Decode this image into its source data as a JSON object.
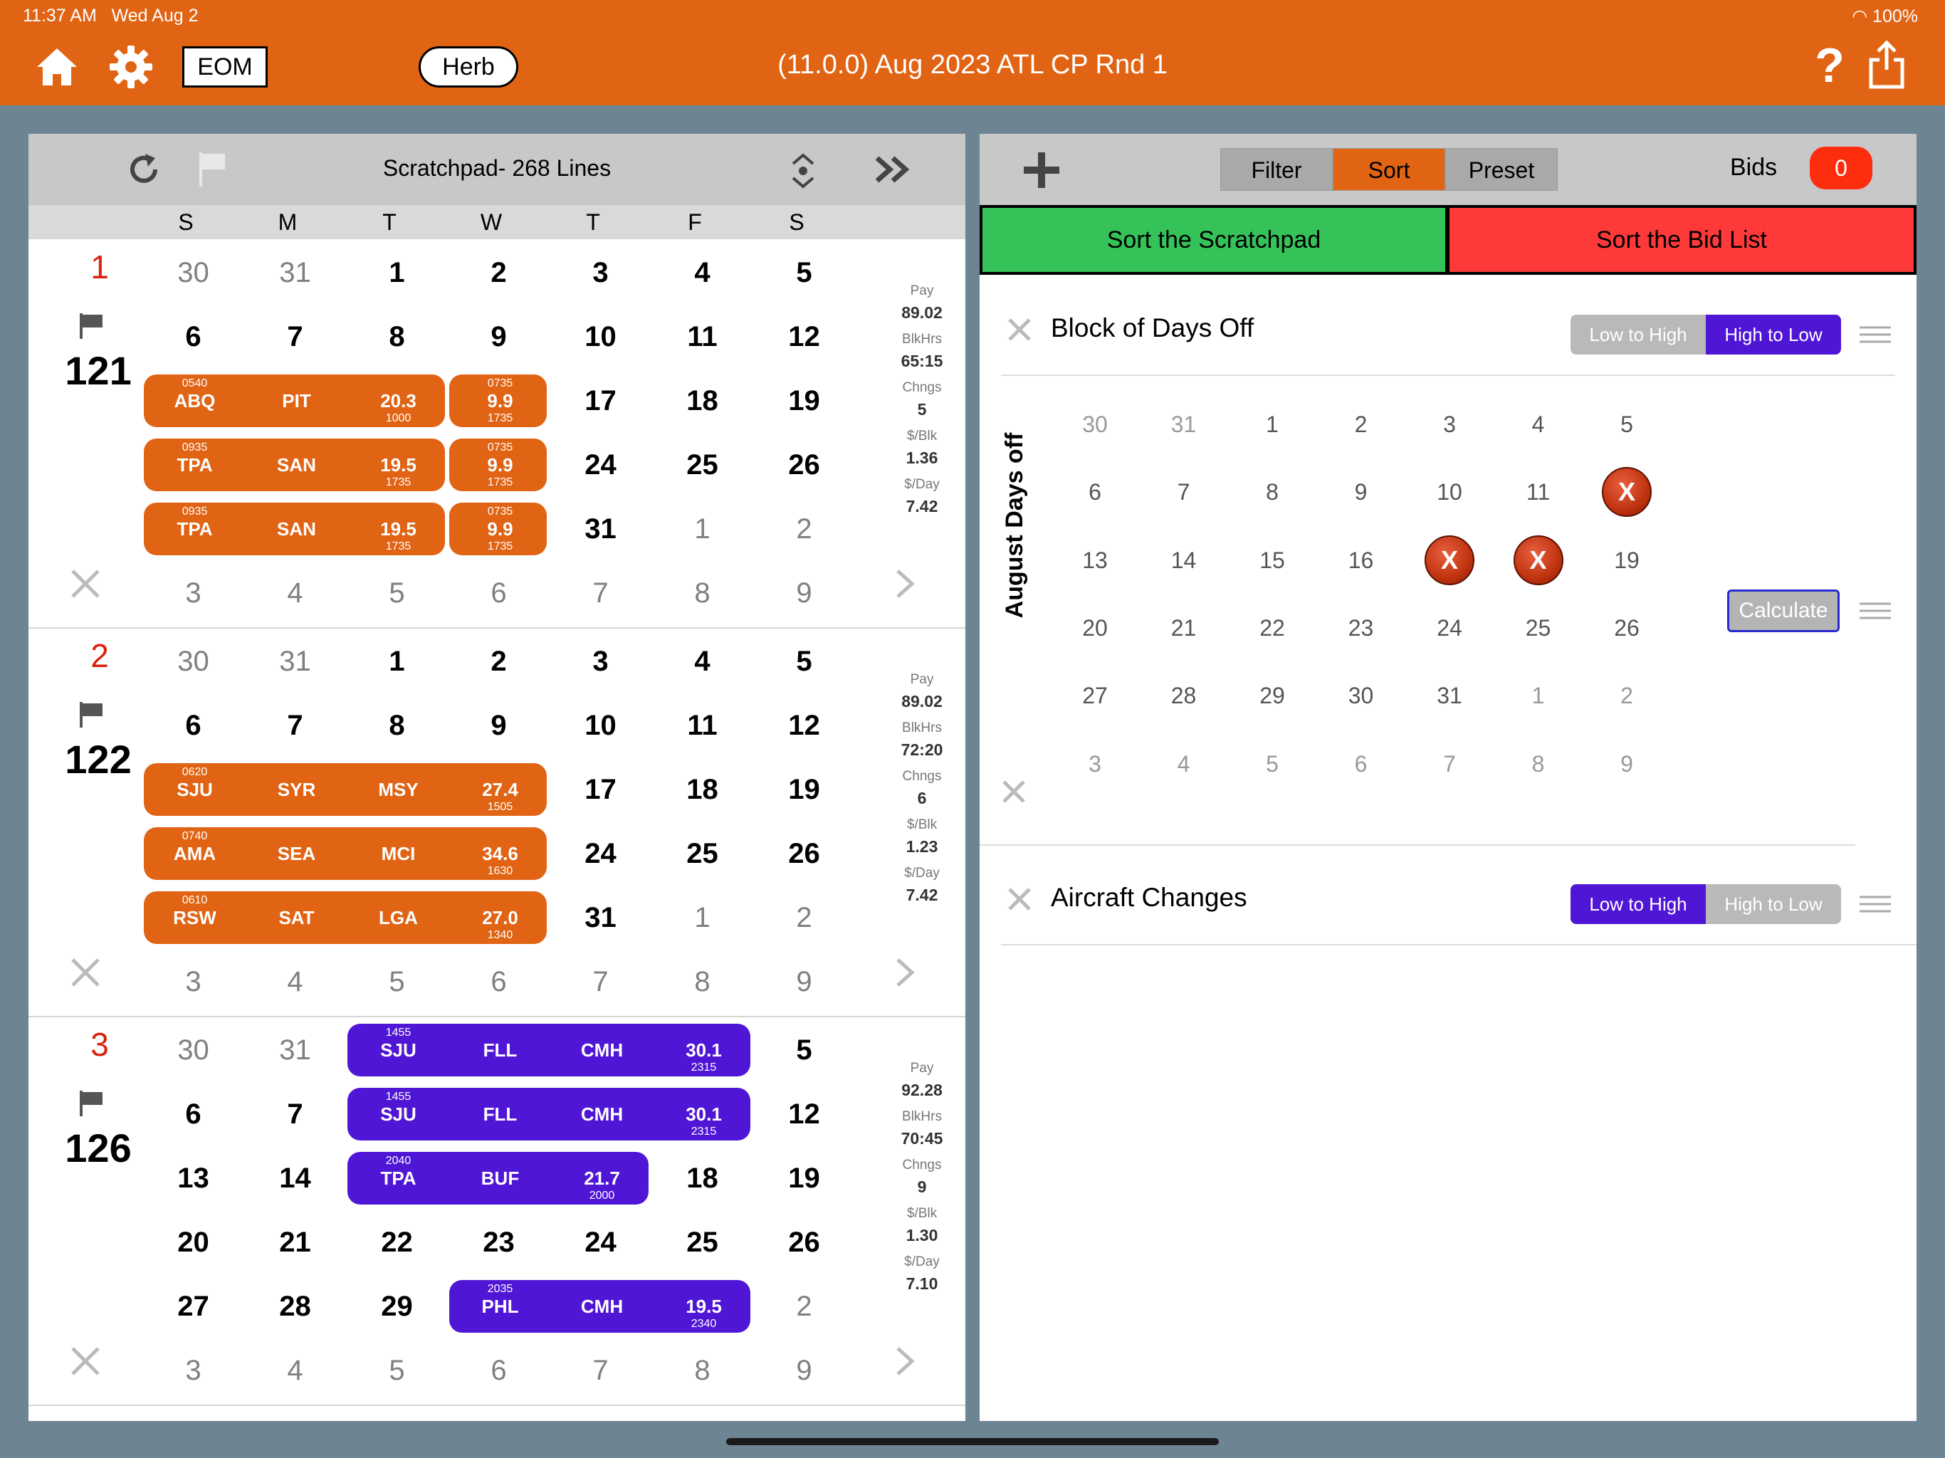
{
  "status": {
    "time": "11:37 AM",
    "date": "Wed Aug 2",
    "battery": "100%"
  },
  "header": {
    "eom_label": "EOM",
    "user_label": "Herb",
    "title": "(11.0.0) Aug 2023 ATL CP Rnd 1"
  },
  "scratchpad": {
    "title": "Scratchpad- 268 Lines",
    "day_headers": [
      "S",
      "M",
      "T",
      "W",
      "T",
      "F",
      "S"
    ]
  },
  "lines": [
    {
      "rank": "1",
      "line_id": "121",
      "stats": {
        "pay_label": "Pay",
        "pay": "89.02",
        "blk_label": "BlkHrs",
        "blk": "65:15",
        "chg_label": "Chngs",
        "chg": "5",
        "blkrate_label": "$/Blk",
        "blkrate": "1.36",
        "dayrate_label": "$/Day",
        "dayrate": "7.42"
      },
      "calendar_rows": [
        [
          "30",
          "31",
          "1",
          "2",
          "3",
          "4",
          "5"
        ],
        [
          "6",
          "7",
          "8",
          "9",
          "10",
          "11",
          "12"
        ],
        [
          "13",
          "14",
          "15",
          "16",
          "17",
          "18",
          "19"
        ],
        [
          "20",
          "21",
          "22",
          "23",
          "24",
          "25",
          "26"
        ],
        [
          "27",
          "28",
          "29",
          "30",
          "31",
          "1",
          "2"
        ],
        [
          "3",
          "4",
          "5",
          "6",
          "7",
          "8",
          "9"
        ]
      ],
      "trips": [
        {
          "row": 2,
          "start": 0,
          "cells": [
            {
              "top": "0540",
              "main": "ABQ",
              "bottom": ""
            },
            {
              "top": "",
              "main": "PIT",
              "bottom": ""
            },
            {
              "top": "",
              "main": "20.3",
              "bottom": "1000"
            }
          ]
        },
        {
          "row": 2,
          "start": 3,
          "cells": [
            {
              "top": "0735",
              "main": "9.9",
              "bottom": "1735"
            }
          ]
        },
        {
          "row": 3,
          "start": 0,
          "cells": [
            {
              "top": "0935",
              "main": "TPA",
              "bottom": ""
            },
            {
              "top": "",
              "main": "SAN",
              "bottom": ""
            },
            {
              "top": "",
              "main": "19.5",
              "bottom": "1735"
            }
          ]
        },
        {
          "row": 3,
          "start": 3,
          "cells": [
            {
              "top": "0735",
              "main": "9.9",
              "bottom": "1735"
            }
          ]
        },
        {
          "row": 4,
          "start": 0,
          "cells": [
            {
              "top": "0935",
              "main": "TPA",
              "bottom": ""
            },
            {
              "top": "",
              "main": "SAN",
              "bottom": ""
            },
            {
              "top": "",
              "main": "19.5",
              "bottom": "1735"
            }
          ]
        },
        {
          "row": 4,
          "start": 3,
          "cells": [
            {
              "top": "0735",
              "main": "9.9",
              "bottom": "1735"
            }
          ]
        }
      ],
      "trip_color": "#e06414"
    },
    {
      "rank": "2",
      "line_id": "122",
      "stats": {
        "pay_label": "Pay",
        "pay": "89.02",
        "blk_label": "BlkHrs",
        "blk": "72:20",
        "chg_label": "Chngs",
        "chg": "6",
        "blkrate_label": "$/Blk",
        "blkrate": "1.23",
        "dayrate_label": "$/Day",
        "dayrate": "7.42"
      },
      "calendar_rows": [
        [
          "30",
          "31",
          "1",
          "2",
          "3",
          "4",
          "5"
        ],
        [
          "6",
          "7",
          "8",
          "9",
          "10",
          "11",
          "12"
        ],
        [
          "13",
          "14",
          "15",
          "16",
          "17",
          "18",
          "19"
        ],
        [
          "20",
          "21",
          "22",
          "23",
          "24",
          "25",
          "26"
        ],
        [
          "27",
          "28",
          "29",
          "30",
          "31",
          "1",
          "2"
        ],
        [
          "3",
          "4",
          "5",
          "6",
          "7",
          "8",
          "9"
        ]
      ],
      "trips": [
        {
          "row": 2,
          "start": 0,
          "cells": [
            {
              "top": "0620",
              "main": "SJU",
              "bottom": ""
            },
            {
              "top": "",
              "main": "SYR",
              "bottom": ""
            },
            {
              "top": "",
              "main": "MSY",
              "bottom": ""
            },
            {
              "top": "",
              "main": "27.4",
              "bottom": "1505"
            }
          ]
        },
        {
          "row": 3,
          "start": 0,
          "cells": [
            {
              "top": "0740",
              "main": "AMA",
              "bottom": ""
            },
            {
              "top": "",
              "main": "SEA",
              "bottom": ""
            },
            {
              "top": "",
              "main": "MCI",
              "bottom": ""
            },
            {
              "top": "",
              "main": "34.6",
              "bottom": "1630"
            }
          ]
        },
        {
          "row": 4,
          "start": 0,
          "cells": [
            {
              "top": "0610",
              "main": "RSW",
              "bottom": ""
            },
            {
              "top": "",
              "main": "SAT",
              "bottom": ""
            },
            {
              "top": "",
              "main": "LGA",
              "bottom": ""
            },
            {
              "top": "",
              "main": "27.0",
              "bottom": "1340"
            }
          ]
        }
      ],
      "trip_color": "#e06414"
    },
    {
      "rank": "3",
      "line_id": "126",
      "stats": {
        "pay_label": "Pay",
        "pay": "92.28",
        "blk_label": "BlkHrs",
        "blk": "70:45",
        "chg_label": "Chngs",
        "chg": "9",
        "blkrate_label": "$/Blk",
        "blkrate": "1.30",
        "dayrate_label": "$/Day",
        "dayrate": "7.10"
      },
      "calendar_rows": [
        [
          "30",
          "31",
          "1",
          "2",
          "3",
          "4",
          "5"
        ],
        [
          "6",
          "7",
          "8",
          "9",
          "10",
          "11",
          "12"
        ],
        [
          "13",
          "14",
          "15",
          "16",
          "17",
          "18",
          "19"
        ],
        [
          "20",
          "21",
          "22",
          "23",
          "24",
          "25",
          "26"
        ],
        [
          "27",
          "28",
          "29",
          "30",
          "31",
          "1",
          "2"
        ],
        [
          "3",
          "4",
          "5",
          "6",
          "7",
          "8",
          "9"
        ]
      ],
      "trips": [
        {
          "row": 0,
          "start": 2,
          "cells": [
            {
              "top": "1455",
              "main": "SJU",
              "bottom": ""
            },
            {
              "top": "",
              "main": "FLL",
              "bottom": ""
            },
            {
              "top": "",
              "main": "CMH",
              "bottom": ""
            },
            {
              "top": "",
              "main": "30.1",
              "bottom": "2315"
            }
          ]
        },
        {
          "row": 1,
          "start": 2,
          "cells": [
            {
              "top": "1455",
              "main": "SJU",
              "bottom": ""
            },
            {
              "top": "",
              "main": "FLL",
              "bottom": ""
            },
            {
              "top": "",
              "main": "CMH",
              "bottom": ""
            },
            {
              "top": "",
              "main": "30.1",
              "bottom": "2315"
            }
          ]
        },
        {
          "row": 2,
          "start": 2,
          "cells": [
            {
              "top": "2040",
              "main": "TPA",
              "bottom": ""
            },
            {
              "top": "",
              "main": "BUF",
              "bottom": ""
            },
            {
              "top": "",
              "main": "21.7",
              "bottom": "2000"
            }
          ]
        },
        {
          "row": 4,
          "start": 3,
          "cells": [
            {
              "top": "2035",
              "main": "PHL",
              "bottom": ""
            },
            {
              "top": "",
              "main": "CMH",
              "bottom": ""
            },
            {
              "top": "",
              "main": "19.5",
              "bottom": "2340"
            }
          ]
        }
      ],
      "trip_color": "#5016d6"
    }
  ],
  "sort_panel": {
    "tabs": [
      "Filter",
      "Sort",
      "Preset"
    ],
    "active_tab": "Sort",
    "bids_label": "Bids",
    "bids_count": "0",
    "sort_scratchpad_label": "Sort the Scratchpad",
    "sort_bidlist_label": "Sort the Bid List",
    "criteria": [
      {
        "title": "Block of Days Off",
        "low_label": "Low to High",
        "high_label": "High to Low",
        "selected": "High to Low"
      },
      {
        "title": "Aircraft Changes",
        "low_label": "Low to High",
        "high_label": "High to Low",
        "selected": "Low to High"
      }
    ],
    "days_off": {
      "label": "August Days off",
      "rows": [
        [
          "30",
          "31",
          "1",
          "2",
          "3",
          "4",
          "5"
        ],
        [
          "6",
          "7",
          "8",
          "9",
          "10",
          "11",
          "12"
        ],
        [
          "13",
          "14",
          "15",
          "16",
          "17",
          "18",
          "19"
        ],
        [
          "20",
          "21",
          "22",
          "23",
          "24",
          "25",
          "26"
        ],
        [
          "27",
          "28",
          "29",
          "30",
          "31",
          "1",
          "2"
        ],
        [
          "3",
          "4",
          "5",
          "6",
          "7",
          "8",
          "9"
        ]
      ],
      "marked_days": [
        "12",
        "17",
        "18"
      ],
      "mark_label": "X",
      "calculate_label": "Calculate"
    }
  },
  "colors": {
    "accent_orange": "#e06414",
    "purple": "#5016d6",
    "green": "#35c359",
    "red": "#fe3939"
  }
}
